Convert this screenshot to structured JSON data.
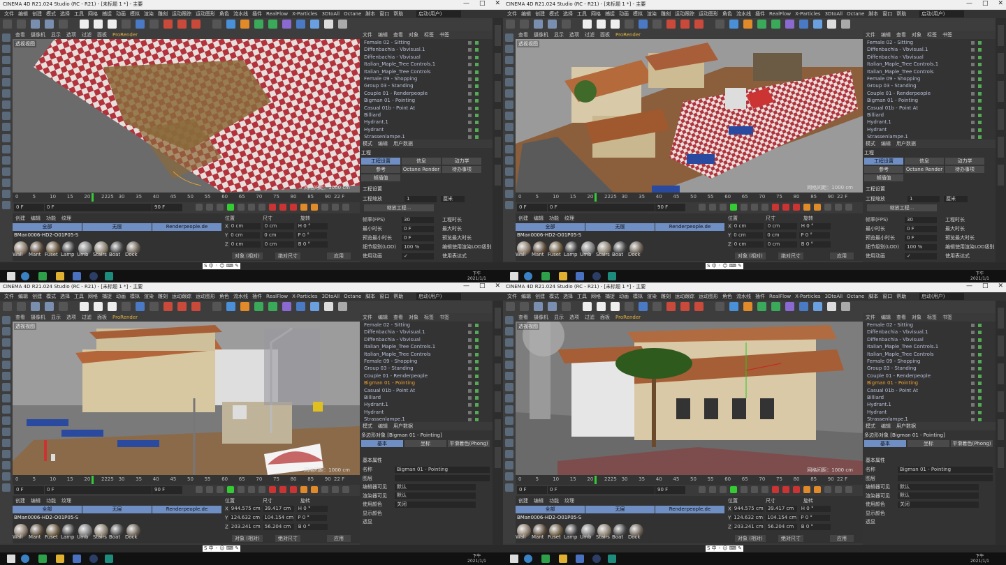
{
  "titlebar": {
    "title": "CINEMA 4D R21.024 Studio (RC - R21) - [未标题 1 *] - 主要",
    "controls": [
      "—",
      "□",
      "✕"
    ]
  },
  "menu": [
    "文件",
    "编辑",
    "创建",
    "模式",
    "选择",
    "工具",
    "网格",
    "捕捉",
    "动画",
    "模拟",
    "渲染",
    "雕刻",
    "运动跟踪",
    "运动图形",
    "角色",
    "流水线",
    "插件",
    "RealFlow",
    "X-Particles",
    "3DtoAll",
    "Octane",
    "脚本",
    "窗口",
    "帮助"
  ],
  "layout": {
    "label": "界面",
    "value": "启动(用户)"
  },
  "viewport_menu": [
    "查看",
    "摄像机",
    "显示",
    "选项",
    "过滤",
    "面板"
  ],
  "prorender": "ProRender",
  "viewport_label": "透视视图",
  "grid_info": "网格间距：1000 cm",
  "timeline_ticks": [
    "0",
    "5",
    "10",
    "15",
    "20",
    "2225",
    "30",
    "35",
    "40",
    "45",
    "50",
    "55",
    "60",
    "65",
    "70",
    "75",
    "80",
    "85",
    "90"
  ],
  "timeline_end": "22 F",
  "play": {
    "start": "0 F",
    "start2": "0 F",
    "end": "90 F",
    "end2": "90 F"
  },
  "materials": {
    "menu": [
      "创建",
      "编辑",
      "功能",
      "纹理"
    ],
    "layers": [
      "全部",
      "无层",
      "Renderpeople.de"
    ],
    "current": "BMan0006-HD2-O01P05-S",
    "items": [
      "Wall",
      "Mant",
      "Fuset",
      "Lamp",
      "Umb",
      "Stairs",
      "Boat",
      "Dock"
    ]
  },
  "objects": {
    "menu": [
      "文件",
      "编辑",
      "查看",
      "对象",
      "标签",
      "书签"
    ],
    "items": [
      "Female 02 - Sitting",
      "Diffenbachia - Vbvisual.1",
      "Diffenbachia - Vbvisual",
      "Italian_Maple_Tree Controls.1",
      "Italian_Maple_Tree Controls",
      "Female 09 - Shopping",
      "Group 03 - Standing",
      "Couple 01 - Renderpeople",
      "Bigman 01 - Pointing",
      "Casual 01b - Point At",
      "Billiard",
      "Hydrant.1",
      "Hydrant",
      "Strassenlampe.1",
      "Strassenlampe"
    ]
  },
  "attr_menu": [
    "模式",
    "编辑",
    "用户数据"
  ],
  "project": {
    "title": "工程",
    "tabs": [
      "工程设置",
      "信息",
      "动力学",
      "参考",
      "Octane Render",
      "待办事项",
      "帧插值"
    ],
    "section": "工程设置",
    "scale_label": "工程缩放",
    "scale_value": "1",
    "scale_unit": "厘米",
    "scale_btn": "缩放工程...",
    "rows": [
      {
        "label": "帧率(FPS)",
        "value": "30",
        "label2": "工程时长"
      },
      {
        "label": "最小时长",
        "value": "0 F",
        "label2": "最大时长"
      },
      {
        "label": "预览最小时长",
        "value": "0 F",
        "label2": "预览最大时长"
      },
      {
        "label": "细节级别(LOD)",
        "value": "100 %",
        "label2": "编辑使用渲染LOD级别"
      },
      {
        "label": "使用动画",
        "value": "✓",
        "label2": "使用表达式"
      }
    ]
  },
  "object_attr": {
    "title": "多边形对象 [Bigman 01 - Pointing]",
    "tabs": [
      "基本",
      "坐标",
      "平滑着色(Phong)"
    ],
    "section": "基本属性",
    "rows": [
      {
        "label": "名称",
        "value": "Bigman 01 - Pointing"
      },
      {
        "label": "图层",
        "value": ""
      },
      {
        "label": "编辑器可见",
        "value": "默认"
      },
      {
        "label": "渲染器可见",
        "value": "默认"
      },
      {
        "label": "使用颜色",
        "value": "关闭"
      },
      {
        "label": "显示颜色",
        "value": ""
      },
      {
        "label": "透显",
        "value": ""
      }
    ]
  },
  "coords": {
    "headers": [
      "位置",
      "尺寸",
      "旋转"
    ],
    "empty": [
      {
        "x": "0 cm",
        "s": "0 cm",
        "r": "H 0 °"
      },
      {
        "x": "0 cm",
        "s": "0 cm",
        "r": "P 0 °"
      },
      {
        "x": "0 cm",
        "s": "0 cm",
        "r": "B 0 °"
      }
    ],
    "sel": [
      {
        "x": "944.575 cm",
        "s": "39.417 cm",
        "r": "H 0 °"
      },
      {
        "x": "124.632 cm",
        "s": "104.154 cm",
        "r": "P 0 °"
      },
      {
        "x": "203.241 cm",
        "s": "56.204 cm",
        "r": "B 0 °"
      }
    ],
    "mode1": "对象 (相对)",
    "mode2": "绝对尺寸",
    "apply": "应用"
  },
  "clock": {
    "time": "下午",
    "date": "2021/1/1"
  },
  "ime": "S 中 ◦ ☺ ⌨ ✎",
  "quads": [
    {
      "scene": "checker",
      "attr": "project",
      "sel": -1,
      "coords": "empty"
    },
    {
      "scene": "town",
      "attr": "project",
      "sel": -1,
      "coords": "empty"
    },
    {
      "scene": "street",
      "attr": "object",
      "sel": 8,
      "coords": "sel"
    },
    {
      "scene": "building",
      "attr": "object",
      "sel": 8,
      "coords": "sel"
    }
  ],
  "colors": {
    "accent": "#6f8fc4",
    "selected": "#f0a030",
    "checker_red": "#b4323c",
    "checker_white": "#e6e0dc"
  }
}
